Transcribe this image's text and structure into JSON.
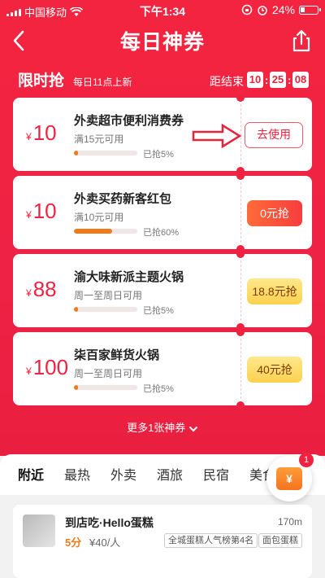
{
  "status": {
    "carrier": "中国移动",
    "time": "下午1:34",
    "battery": "24%"
  },
  "nav": {
    "title": "每日神券"
  },
  "flash": {
    "title": "限时抢",
    "subtitle": "每日11点上新",
    "countdown_label": "距结束",
    "countdown": {
      "h": "10",
      "m": "25",
      "s": "08"
    }
  },
  "coupons": [
    {
      "currency": "¥",
      "amount": "10",
      "name": "外卖超市便利消费券",
      "condition": "满15元可用",
      "taken": "已抢5%",
      "progress": 0.05,
      "button": "去使用"
    },
    {
      "currency": "¥",
      "amount": "10",
      "name": "外卖买药新客红包",
      "condition": "满10元可用",
      "taken": "已抢60%",
      "progress": 0.6,
      "button": "0元抢"
    },
    {
      "currency": "¥",
      "amount": "88",
      "name": "渝大味新派主题火锅",
      "condition": "周一至周日可用",
      "taken": "已抢5%",
      "progress": 0.05,
      "button": "18.8元抢"
    },
    {
      "currency": "¥",
      "amount": "100",
      "name": "柒百家鲜货火锅",
      "condition": "周一至周日可用",
      "taken": "已抢5%",
      "progress": 0.05,
      "button": "40元抢"
    }
  ],
  "more": "更多1张神券",
  "tabs": [
    "附近",
    "最热",
    "外卖",
    "酒旅",
    "民宿",
    "美食"
  ],
  "float_button": {
    "symbol": "¥",
    "badge": "1"
  },
  "shop": {
    "name": "到店吃·Hello蛋糕",
    "distance": "170m",
    "score": "5分",
    "price": "¥40/人",
    "tags": [
      "全城蛋糕人气榜第4名",
      "面包蛋糕"
    ]
  },
  "colors": {
    "primary_red": "#ef2242",
    "progress_orange": "#f07a1a",
    "gold": "#fbd14f"
  }
}
